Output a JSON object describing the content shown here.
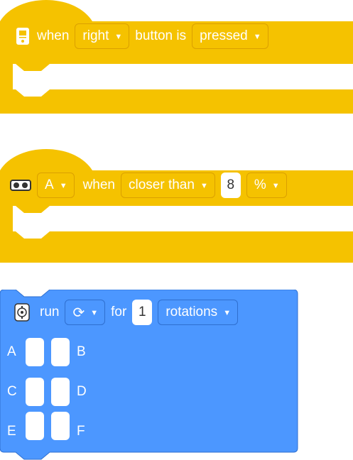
{
  "colors": {
    "event_yellow": "#f5c200",
    "event_border": "#dba000",
    "motor_blue": "#4c97ff",
    "motor_border": "#2f6fcf"
  },
  "block1": {
    "icon": "hub-icon",
    "when_label": "when",
    "button_value": "right",
    "mid_label": "button is",
    "state_value": "pressed"
  },
  "block2": {
    "icon": "distance-sensor-icon",
    "port_value": "A",
    "when_label": "when",
    "compare_value": "closer than",
    "distance_value": "8",
    "unit_value": "%"
  },
  "block3": {
    "icon": "motor-icon",
    "run_label": "run",
    "direction_icon": "clockwise-icon",
    "direction_glyph": "⟳",
    "for_label": "for",
    "amount_value": "1",
    "unit_value": "rotations",
    "ports": [
      "A",
      "B",
      "C",
      "D",
      "E",
      "F"
    ]
  }
}
